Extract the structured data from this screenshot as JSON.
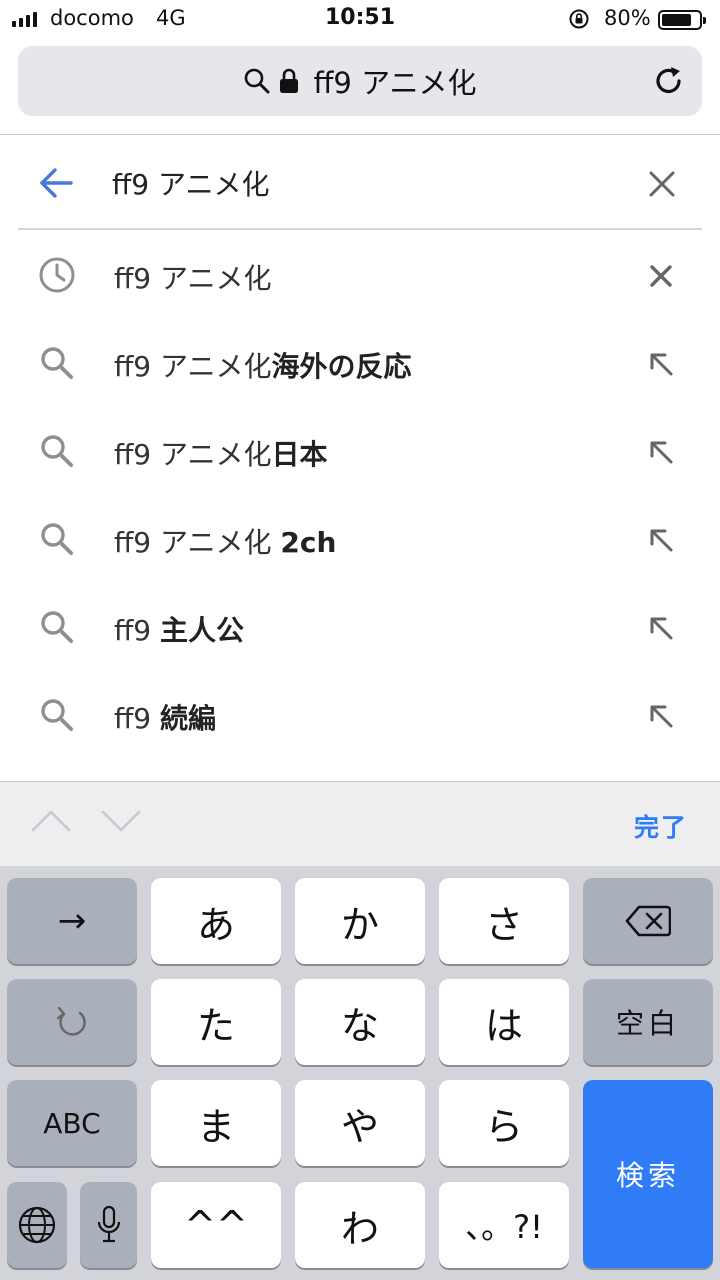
{
  "status_bar": {
    "carrier": "docomo",
    "network": "4G",
    "time": "10:51",
    "battery_percent": "80%",
    "battery_level": 0.8
  },
  "url_bar": {
    "query": "ff9 アニメ化"
  },
  "search": {
    "value": "ff9 アニメ化"
  },
  "suggestions": [
    {
      "type": "history",
      "prefix": "ff9 アニメ化",
      "bold": ""
    },
    {
      "type": "search",
      "prefix": "ff9 アニメ化",
      "bold": "海外の反応"
    },
    {
      "type": "search",
      "prefix": "ff9 アニメ化",
      "bold": "日本"
    },
    {
      "type": "search",
      "prefix": "ff9 アニメ化 ",
      "bold": "2ch"
    },
    {
      "type": "search",
      "prefix": "ff9 ",
      "bold": "主人公"
    },
    {
      "type": "search",
      "prefix": "ff9 ",
      "bold": "続編"
    }
  ],
  "accessory": {
    "done_label": "完了"
  },
  "keyboard": {
    "row1": [
      "→",
      "あ",
      "か",
      "さ"
    ],
    "row2": [
      "た",
      "な",
      "は",
      "空白"
    ],
    "row3": [
      "ABC",
      "ま",
      "や",
      "ら",
      "検索"
    ],
    "row4": [
      "^^",
      "わ",
      "、。?!"
    ]
  },
  "colors": {
    "accent": "#2f7cf6",
    "icon_gray": "#8e8e93",
    "keyboard_bg": "#d2d4d9"
  }
}
